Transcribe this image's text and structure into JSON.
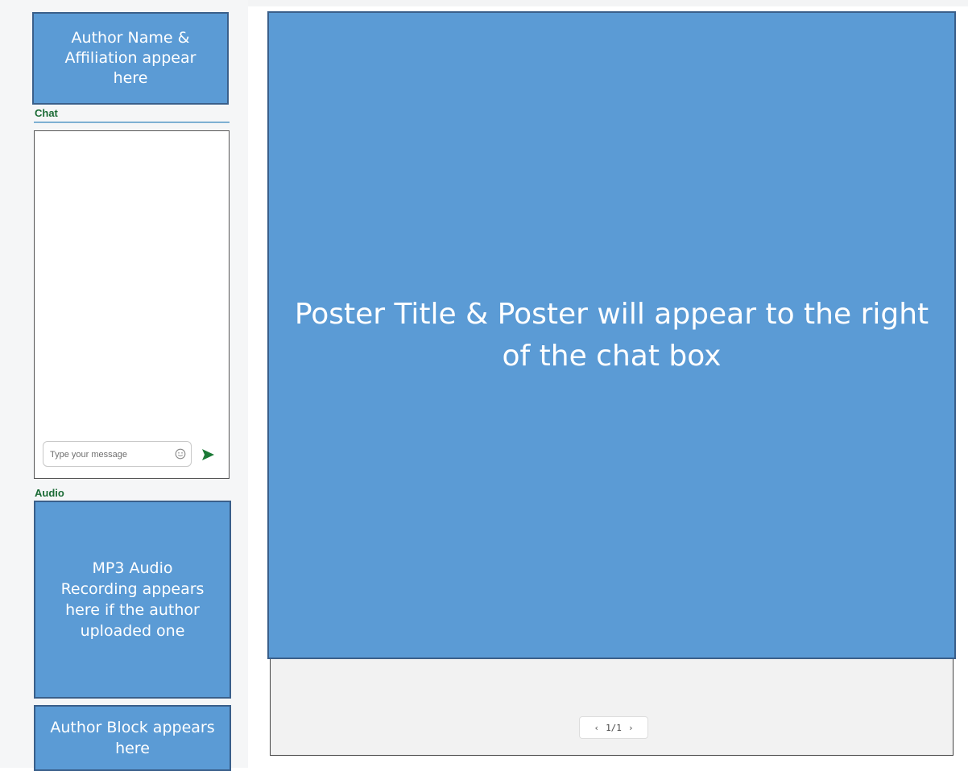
{
  "sidebar": {
    "author_box": {
      "lines": [
        "Author Name &",
        "Affiliation appear",
        "here"
      ]
    },
    "chat": {
      "label": "Chat",
      "input_placeholder": "Type your message",
      "emoji_icon": "smiley-icon",
      "send_icon": "send-arrow-icon"
    },
    "audio": {
      "label": "Audio",
      "lines": [
        "MP3 Audio",
        "Recording appears",
        "here if the author",
        "uploaded one"
      ]
    },
    "author_block": {
      "lines": [
        "Author Block appears",
        "here"
      ]
    }
  },
  "main": {
    "poster": {
      "lines": [
        "Poster Title & Poster will appear to the right",
        "of the chat box"
      ]
    },
    "pager": {
      "prev": "‹",
      "page_text": "1/1",
      "next": "›"
    }
  },
  "colors": {
    "placeholder_fill": "#5b9bd5",
    "label_green": "#1b6b35",
    "send_green": "#1b7a36"
  }
}
